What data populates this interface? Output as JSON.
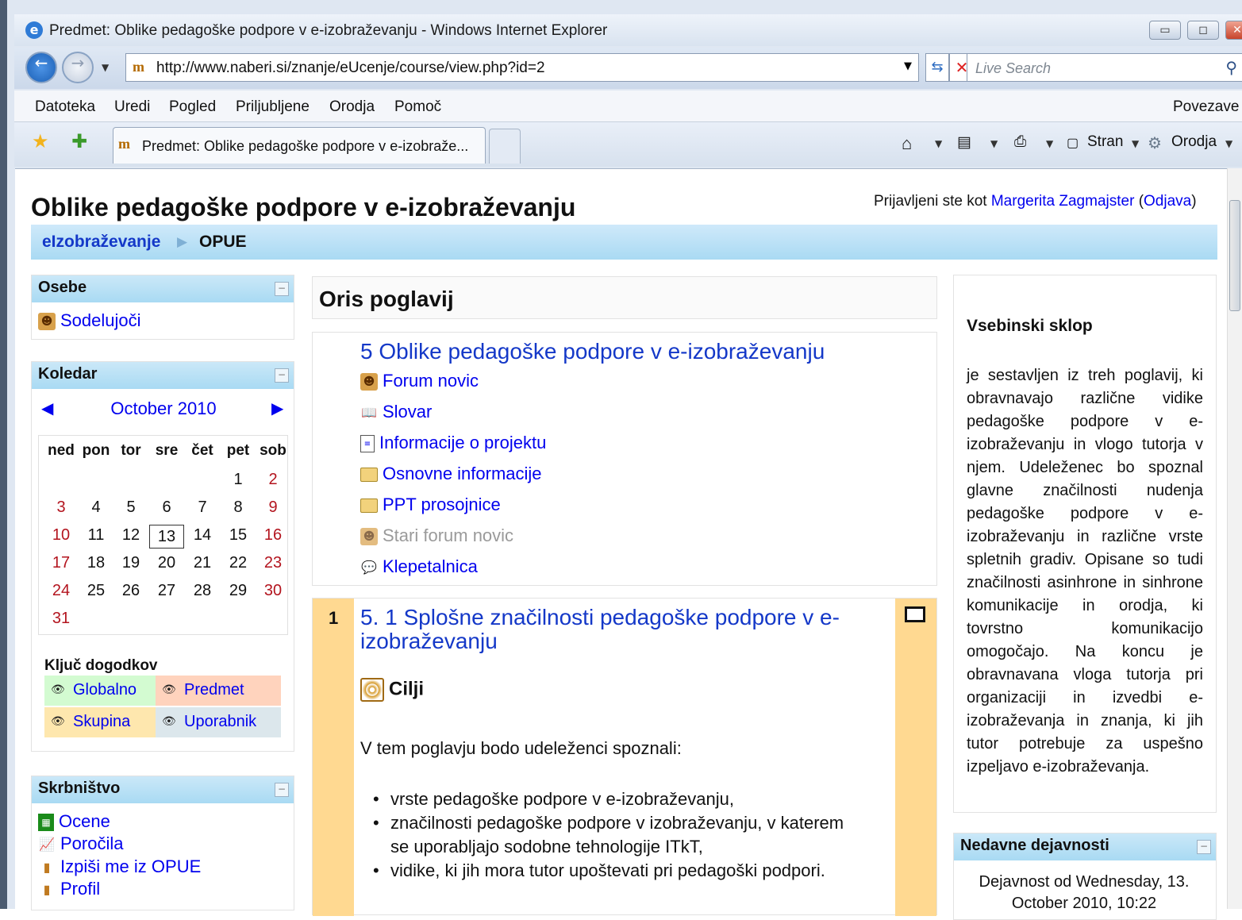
{
  "window": {
    "title": "Predmet: Oblike pedagoške podpore v e-izobraževanju - Windows Internet Explorer",
    "minimize": "▭",
    "maximize": "◻",
    "close": "✕"
  },
  "address": {
    "url": "http://www.naberi.si/znanje/eUcenje/course/view.php?id=2",
    "favicon": "m",
    "search_placeholder": "Live Search"
  },
  "menu": [
    "Datoteka",
    "Uredi",
    "Pogled",
    "Priljubljene",
    "Orodja",
    "Pomoč"
  ],
  "menu_links": "Povezave",
  "tab": {
    "title": "Predmet: Oblike pedagoške podpore v e-izobraže..."
  },
  "toolbar": {
    "page": "Stran",
    "tools": "Orodja"
  },
  "page": {
    "title": "Oblike pedagoške podpore v e-izobraževanju",
    "login_prefix": "Prijavljeni ste kot",
    "user": "Margerita Zagmajster",
    "logout": "Odjava",
    "breadcrumb": {
      "home": "eIzobraževanje",
      "current": "OPUE"
    }
  },
  "blocks": {
    "people": {
      "title": "Osebe",
      "items": [
        "Sodelujoči"
      ]
    },
    "calendar": {
      "title": "Koledar",
      "month": "October 2010",
      "days": [
        "ned",
        "pon",
        "tor",
        "sre",
        "čet",
        "pet",
        "sob"
      ],
      "weeks": [
        [
          "",
          "",
          "",
          "",
          "",
          "1",
          "2"
        ],
        [
          "3",
          "4",
          "5",
          "6",
          "7",
          "8",
          "9"
        ],
        [
          "10",
          "11",
          "12",
          "13",
          "14",
          "15",
          "16"
        ],
        [
          "17",
          "18",
          "19",
          "20",
          "21",
          "22",
          "23"
        ],
        [
          "24",
          "25",
          "26",
          "27",
          "28",
          "29",
          "30"
        ],
        [
          "31",
          "",
          "",
          "",
          "",
          "",
          ""
        ]
      ],
      "today": "13",
      "legend_title": "Ključ dogodkov",
      "legend": [
        "Globalno",
        "Predmet",
        "Skupina",
        "Uporabnik"
      ],
      "legend_colors": [
        "#d3fbd1",
        "#ffd3bd",
        "#fee7ae",
        "#dce7ec"
      ]
    },
    "admin": {
      "title": "Skrbništvo",
      "items": [
        "Ocene",
        "Poročila",
        "Izpiši me iz OPUE",
        "Profil"
      ]
    }
  },
  "center": {
    "heading": "Oris poglavij",
    "section0": {
      "title": "5 Oblike pedagoške podpore v e-izobraževanju",
      "items": [
        "Forum novic",
        "Slovar",
        "Informacije o projektu",
        "Osnovne informacije",
        "PPT prosojnice",
        "Stari forum novic",
        "Klepetalnica"
      ]
    },
    "section1": {
      "number": "1",
      "title_line1": "5. 1 Splošne značilnosti pedagoške podpore v e-",
      "title_line2": "izobraževanju",
      "goal": "Cilji",
      "intro": "V tem poglavju bodo udeleženci spoznali:",
      "bullets": [
        "vrste pedagoške podpore v e-izobraževanju,",
        "značilnosti pedagoške podpore v izobraževanju, v katerem",
        "se uporabljajo sodobne tehnologije ITkT,",
        "vidike, ki jih mora tutor upoštevati pri pedagoški podpori."
      ]
    }
  },
  "right": {
    "heading": "Vsebinski sklop",
    "text": "je sestavljen iz treh poglavij, ki obravnavajo različne vidike pedagoške podpore v e-izobraževanju in vlogo tutorja v njem. Udeleženec bo spoznal glavne značilnosti nudenja pedagoške podpore v e-izobraževanju in različne vrste spletnih gradiv. Opisane so tudi značilnosti asinhrone in sinhrone komunikacije in orodja, ki tovrstno komunikacijo omogočajo. Na koncu je obravnavana vloga tutorja pri organizaciji in izvedbi e-izobraževanja in znanja, ki jih tutor potrebuje za uspešno izpeljavo e-izobraževanja.",
    "recent_title": "Nedavne dejavnosti",
    "recent_text": "Dejavnost od Wednesday, 13. October 2010, 10:22"
  }
}
